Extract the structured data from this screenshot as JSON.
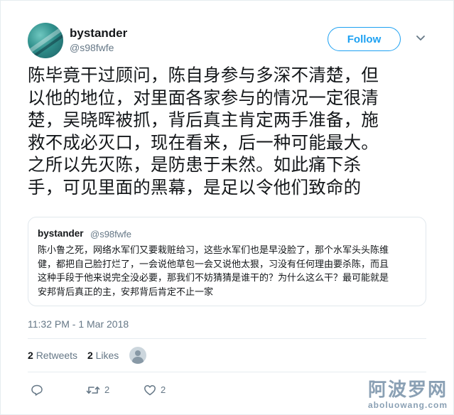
{
  "author": {
    "name": "bystander",
    "handle": "@s98fwfe",
    "avatar_icon": "avatar-image"
  },
  "follow_button": {
    "label": "Follow"
  },
  "menu_icon": "chevron-down-icon",
  "tweet": {
    "lines": [
      "陈毕竟干过顾问，陈自身参与多深不清楚，但",
      "以他的地位，对里面各家参与的情况一定很清",
      "楚，吴晓晖被抓，背后真主肯定两手准备，施",
      "救不成必灭口，现在看来，后一种可能最大。",
      "之所以先灭陈，是防患于未然。如此痛下杀",
      "手，可见里面的黑幕，是足以令他们致命的"
    ]
  },
  "quoted_tweet": {
    "name": "bystander",
    "handle": "@s98fwfe",
    "lines": [
      "陈小鲁之死，网络水军们又要栽赃给习，这些水军们也是早没脸了，那个水军头头陈维",
      "健，都把自己脸打烂了，一会说他草包一会又说他太狠，习没有任何理由要杀陈，而且",
      "这种手段于他来说完全没必要，那我们不妨猜猜是谁干的？为什么这么干？最可能就是",
      "安邦背后真正的主，安邦背后肯定不止一家"
    ]
  },
  "timestamp": "11:32 PM - 1 Mar 2018",
  "stats": {
    "retweets_count": "2",
    "retweets_label": "Retweets",
    "likes_count": "2",
    "likes_label": "Likes"
  },
  "actions": {
    "reply_count": "",
    "retweet_count": "2",
    "like_count": "2"
  },
  "watermark": {
    "cn": "阿波罗网",
    "en": "aboluowang.com"
  },
  "colors": {
    "accent": "#1da1f2",
    "text": "#14171a",
    "muted": "#657786",
    "border": "#e1e8ed"
  }
}
